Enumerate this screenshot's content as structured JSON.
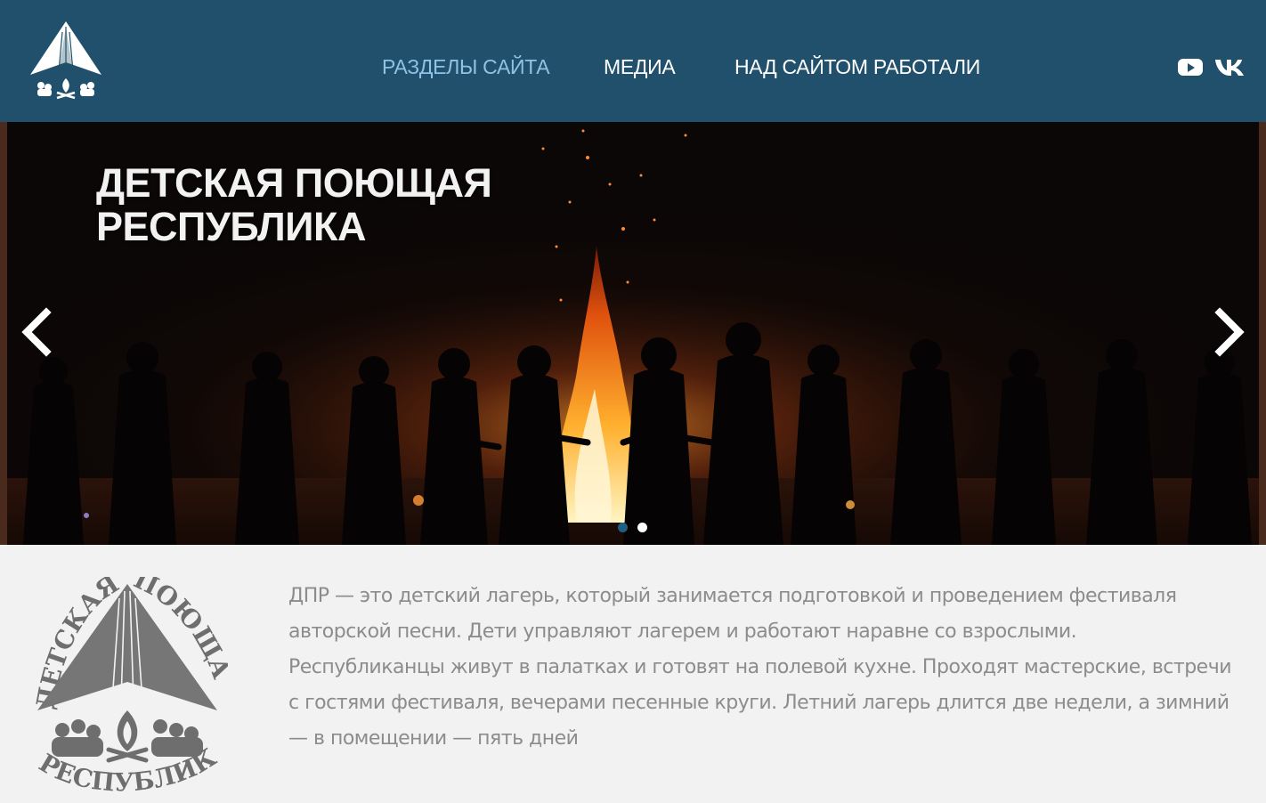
{
  "header": {
    "nav": [
      {
        "label": "РАЗДЕЛЫ САЙТА",
        "active": true
      },
      {
        "label": "МЕДИА",
        "active": false
      },
      {
        "label": "НАД САЙТОМ РАБОТАЛИ",
        "active": false
      }
    ],
    "social": [
      "youtube-icon",
      "vk-icon"
    ],
    "colors": {
      "background": "#20506b",
      "active_link": "#8fc3e3"
    }
  },
  "slider": {
    "title_line1": "ДЕТСКАЯ ПОЮЩАЯ",
    "title_line2": "РЕСПУБЛИКА",
    "slide_count": 2,
    "active_slide": 1
  },
  "about": {
    "text": "ДПР — это детский лагерь, который занимается подготовкой и проведением фестиваля авторской песни. Дети  управляют лагерем и работают наравне со взрослыми. Республиканцы живут в палатках и готовят на полевой кухне. Проходят мастерские, встречи с гостями фестиваля, вечерами песенные круги. Летний лагерь длится две недели, а зимний —  в помещении — пять дней",
    "emblem": {
      "word_top_left": "ДЕТСКАЯ",
      "word_top_right": "ПОЮЩАЯ",
      "word_bottom": "РЕСПУБЛИКА"
    }
  }
}
